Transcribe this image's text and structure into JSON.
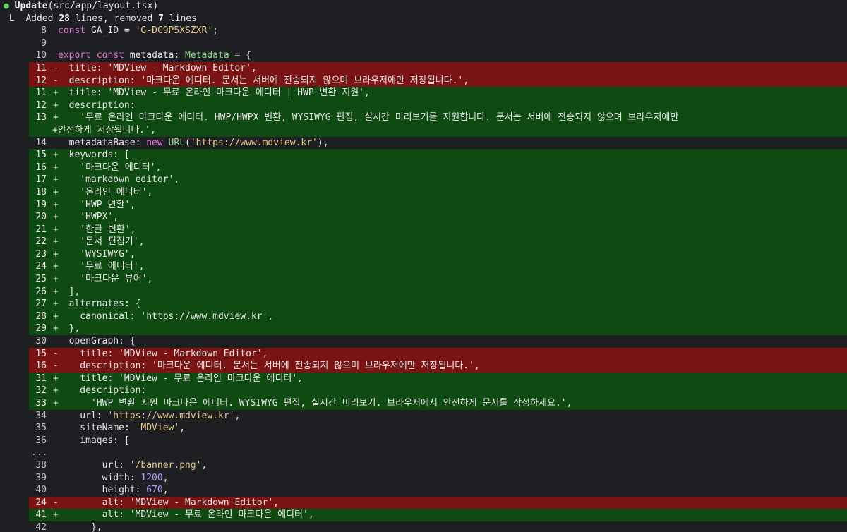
{
  "header": {
    "bullet": "●",
    "action": "Update",
    "path": "(src/app/layout.tsx)"
  },
  "summary": {
    "prefix": "L",
    "added_label": "Added",
    "added_count": "28",
    "lines_label": "lines, removed",
    "removed_count": "7",
    "lines_suffix": "lines"
  },
  "colors": {
    "deleted_bg": "#7a1414",
    "added_bg": "#0f4a12",
    "bullet": "#5fd16a"
  },
  "rows": [
    {
      "t": "ctx",
      "n": "8",
      "c": "const GA_ID = 'G-DC9P5XSZXR';"
    },
    {
      "t": "ctx",
      "n": "9",
      "c": ""
    },
    {
      "t": "ctx",
      "n": "10",
      "c": "export const metadata: Metadata = {"
    },
    {
      "t": "del",
      "n": "11",
      "c": "  title: 'MDView - Markdown Editor',"
    },
    {
      "t": "del",
      "n": "12",
      "c": "  description: '마크다운 에디터. 문서는 서버에 전송되지 않으며 브라우저에만 저장됩니다.',"
    },
    {
      "t": "add",
      "n": "11",
      "c": "  title: 'MDView - 무료 온라인 마크다운 에디터 | HWP 변환 지원',"
    },
    {
      "t": "add",
      "n": "12",
      "c": "  description:"
    },
    {
      "t": "add",
      "n": "13",
      "c": "    '무료 온라인 마크다운 에디터. HWP/HWPX 변환, WYSIWYG 편집, 실시간 미리보기를 지원합니다. 문서는 서버에 전송되지 않으며 브라우저에만"
    },
    {
      "t": "addcont",
      "n": "",
      "c": "+안전하게 저장됩니다.',"
    },
    {
      "t": "ctx",
      "n": "14",
      "c": "  metadataBase: new URL('https://www.mdview.kr'),"
    },
    {
      "t": "add",
      "n": "15",
      "c": "  keywords: ["
    },
    {
      "t": "add",
      "n": "16",
      "c": "    '마크다운 에디터',"
    },
    {
      "t": "add",
      "n": "17",
      "c": "    'markdown editor',"
    },
    {
      "t": "add",
      "n": "18",
      "c": "    '온라인 에디터',"
    },
    {
      "t": "add",
      "n": "19",
      "c": "    'HWP 변환',"
    },
    {
      "t": "add",
      "n": "20",
      "c": "    'HWPX',"
    },
    {
      "t": "add",
      "n": "21",
      "c": "    '한글 변환',"
    },
    {
      "t": "add",
      "n": "22",
      "c": "    '문서 편집기',"
    },
    {
      "t": "add",
      "n": "23",
      "c": "    'WYSIWYG',"
    },
    {
      "t": "add",
      "n": "24",
      "c": "    '무료 에디터',"
    },
    {
      "t": "add",
      "n": "25",
      "c": "    '마크다운 뷰어',"
    },
    {
      "t": "add",
      "n": "26",
      "c": "  ],"
    },
    {
      "t": "add",
      "n": "27",
      "c": "  alternates: {"
    },
    {
      "t": "add",
      "n": "28",
      "c": "    canonical: 'https://www.mdview.kr',"
    },
    {
      "t": "add",
      "n": "29",
      "c": "  },"
    },
    {
      "t": "ctx",
      "n": "30",
      "c": "  openGraph: {"
    },
    {
      "t": "del",
      "n": "15",
      "c": "    title: 'MDView - Markdown Editor',"
    },
    {
      "t": "del",
      "n": "16",
      "c": "    description: '마크다운 에디터. 문서는 서버에 전송되지 않으며 브라우저에만 저장됩니다.',"
    },
    {
      "t": "add",
      "n": "31",
      "c": "    title: 'MDView - 무료 온라인 마크다운 에디터',"
    },
    {
      "t": "add",
      "n": "32",
      "c": "    description:"
    },
    {
      "t": "add",
      "n": "33",
      "c": "      'HWP 변환 지원 마크다운 에디터. WYSIWYG 편집, 실시간 미리보기. 브라우저에서 안전하게 문서를 작성하세요.',"
    },
    {
      "t": "ctx",
      "n": "34",
      "c": "    url: 'https://www.mdview.kr',"
    },
    {
      "t": "ctx",
      "n": "35",
      "c": "    siteName: 'MDView',"
    },
    {
      "t": "ctx",
      "n": "36",
      "c": "    images: ["
    },
    {
      "t": "gap",
      "n": "",
      "c": "..."
    },
    {
      "t": "ctx",
      "n": "38",
      "c": "        url: '/banner.png',"
    },
    {
      "t": "ctx",
      "n": "39",
      "c": "        width: 1200,"
    },
    {
      "t": "ctx",
      "n": "40",
      "c": "        height: 670,"
    },
    {
      "t": "del",
      "n": "24",
      "c": "        alt: 'MDView - Markdown Editor',"
    },
    {
      "t": "add",
      "n": "41",
      "c": "        alt: 'MDView - 무료 온라인 마크다운 에디터',"
    },
    {
      "t": "ctx",
      "n": "42",
      "c": "      },"
    }
  ]
}
